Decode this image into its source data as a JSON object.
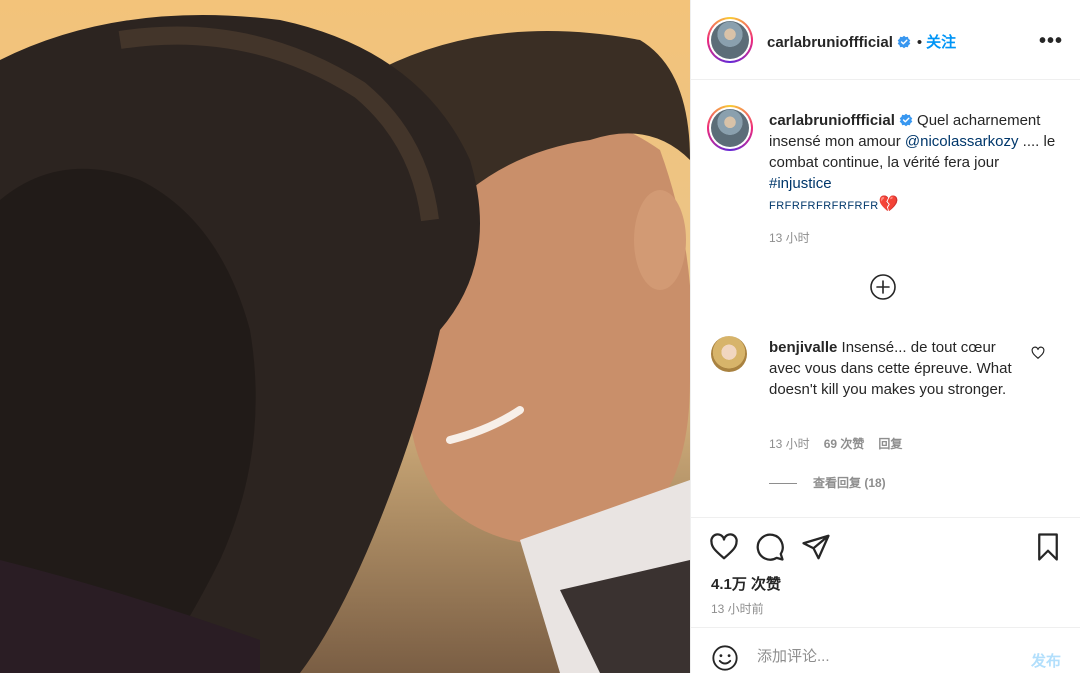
{
  "post": {
    "username": "carlabrunioffficial",
    "follow_label": "关注",
    "separator": "•",
    "more_label": "•••"
  },
  "caption": {
    "username": "carlabrunioffficial",
    "text_1": " Quel acharnement insensé mon amour ",
    "mention": "@nicolassarkozy",
    "text_2": " .... le combat continue, la vérité fera jour ",
    "hashtag": "#injustice",
    "emoji_text": "FRFRFRFRFRFRFR",
    "heart": "💔",
    "time": "13 小时"
  },
  "comment": {
    "username": "benjivalle",
    "text": " Insensé... de tout cœur avec vous dans cette épreuve. What doesn't kill you makes you stronger.",
    "time": "13 小时",
    "likes": "69 次赞",
    "reply_label": "回复",
    "view_replies": "查看回复 (18)"
  },
  "actions": {
    "likes_count": "4.1万 次赞",
    "time_ago": "13 小时前"
  },
  "comment_box": {
    "placeholder": "添加评论...",
    "post_label": "发布"
  },
  "colors": {
    "accent": "#0095f6",
    "link": "#00376b",
    "muted": "#8e8e8e",
    "post_disabled": "#b2dffc"
  }
}
